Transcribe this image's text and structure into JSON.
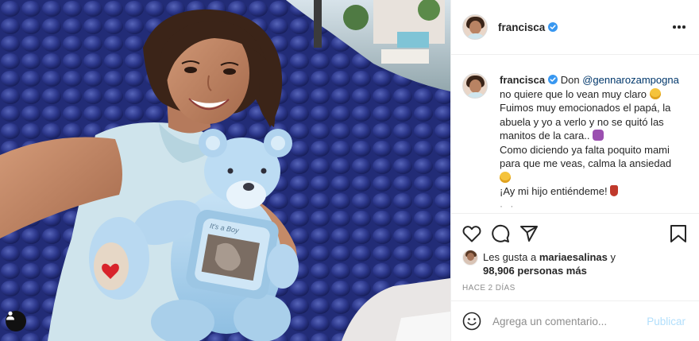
{
  "post": {
    "username": "francisca",
    "verified": true,
    "caption": {
      "username": "francisca",
      "lead": "Don",
      "mention": "@gennarozampogna",
      "line1_rest": "no quiere que lo vean muy claro",
      "line2": "Fuimos muy emocionados el papá, la",
      "line3": "abuela y yo a verlo y no se quitó las",
      "line4": "manitos de la cara..",
      "line5": "Como diciendo ya falta poquito mami",
      "line6": "para que me veas, calma la ansiedad",
      "line7": "¡Ay mi hijo entiéndeme!",
      "more": "· ·"
    },
    "photo": {
      "frame_text": "It's a Boy"
    },
    "likes": {
      "prefix": "Les gusta a",
      "first_user": "mariaesalinas",
      "joiner": "y",
      "others": "98,906 personas más"
    },
    "time": "HACE 2 DÍAS"
  },
  "comment": {
    "placeholder": "Agrega un comentario...",
    "publish_label": "Publicar"
  },
  "colors": {
    "accent_blue": "#0095f6",
    "link_blue": "#00376b",
    "publish_disabled": "#b2dffc",
    "secondary_text": "#8e8e8e"
  },
  "icons": {
    "header_more": "more-horizontal-icon",
    "like": "heart-icon",
    "comment": "comment-icon",
    "share": "share-icon",
    "save": "bookmark-icon",
    "emoji": "smiley-icon",
    "tag": "user-tag-icon"
  }
}
